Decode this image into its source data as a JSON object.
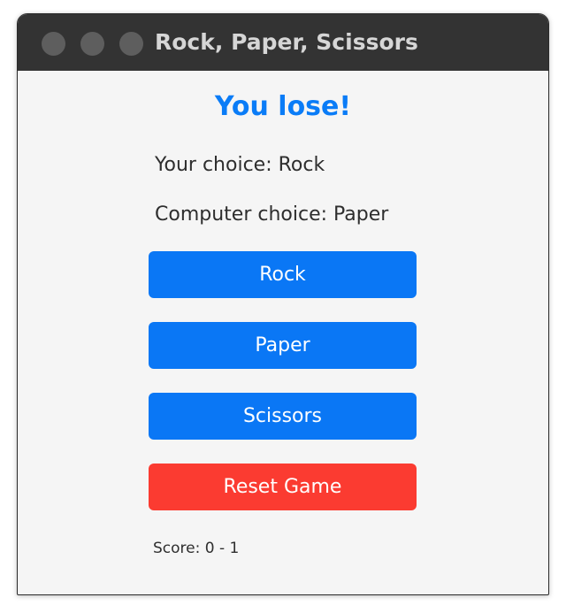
{
  "window": {
    "title": "Rock, Paper, Scissors"
  },
  "game": {
    "result": "You lose!",
    "your_choice": "Your choice: Rock",
    "computer_choice": "Computer choice: Paper",
    "score": "Score: 0 - 1"
  },
  "buttons": {
    "rock": "Rock",
    "paper": "Paper",
    "scissors": "Scissors",
    "reset": "Reset Game"
  },
  "colors": {
    "accent": "#0a77f5",
    "danger": "#fb3b31",
    "result_text": "#0a7cf7",
    "titlebar": "#333333"
  }
}
